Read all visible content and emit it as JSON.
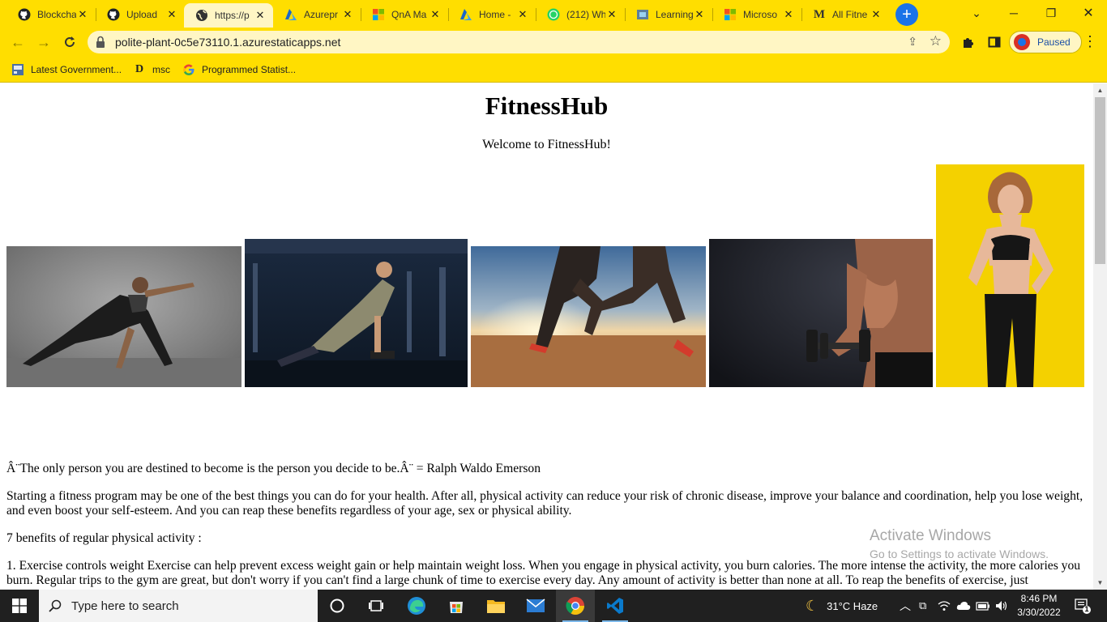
{
  "browser": {
    "tabs": [
      {
        "title": "Blockcha",
        "icon": "github-icon"
      },
      {
        "title": "Upload",
        "icon": "github-icon"
      },
      {
        "title": "https://p",
        "icon": "globe-icon",
        "active": true
      },
      {
        "title": "Azurepr",
        "icon": "azure-icon"
      },
      {
        "title": "QnA Ma",
        "icon": "microsoft-icon"
      },
      {
        "title": "Home -",
        "icon": "azure-icon"
      },
      {
        "title": "(212) Wh",
        "icon": "whatsapp-icon"
      },
      {
        "title": "Learning",
        "icon": "learn-icon"
      },
      {
        "title": "Microso",
        "icon": "microsoft-icon"
      },
      {
        "title": "All Fitne",
        "icon": "medium-icon"
      }
    ],
    "url": "polite-plant-0c5e73110.1.azurestaticapps.net",
    "profile_label": "Paused",
    "bookmarks": [
      {
        "label": "Latest Government...",
        "icon": "gov-icon"
      },
      {
        "label": "msc",
        "icon": "d-icon"
      },
      {
        "label": "Programmed Statist...",
        "icon": "google-icon"
      }
    ],
    "accent": "#ffde00"
  },
  "page": {
    "title": "FitnessHub",
    "welcome": "Welcome to FitnessHub!",
    "quote": "Â¨The only person you are destined to become is the person you decide to be.Â¨ = Ralph Waldo Emerson",
    "intro": "Starting a fitness program may be one of the best things you can do for your health. After all, physical activity can reduce your risk of chronic disease, improve your balance and coordination, help you lose weight, and even boost your self-esteem. And you can reap these benefits regardless of your age, sex or physical ability.",
    "benefits_heading": "7 benefits of regular physical activity :",
    "benefit_1": "1. Exercise controls weight Exercise can help prevent excess weight gain or help maintain weight loss. When you engage in physical activity, you burn calories. The more intense the activity, the more calories you burn. Regular trips to the gym are great, but don't worry if you can't find a large chunk of time to exercise every day. Any amount of activity is better than none at all. To reap the benefits of exercise, just"
  },
  "watermark": {
    "line1": "Activate Windows",
    "line2": "Go to Settings to activate Windows."
  },
  "taskbar": {
    "search_placeholder": "Type here to search",
    "weather": "31°C  Haze",
    "time": "8:46 PM",
    "date": "3/30/2022",
    "notification_count": "1"
  }
}
